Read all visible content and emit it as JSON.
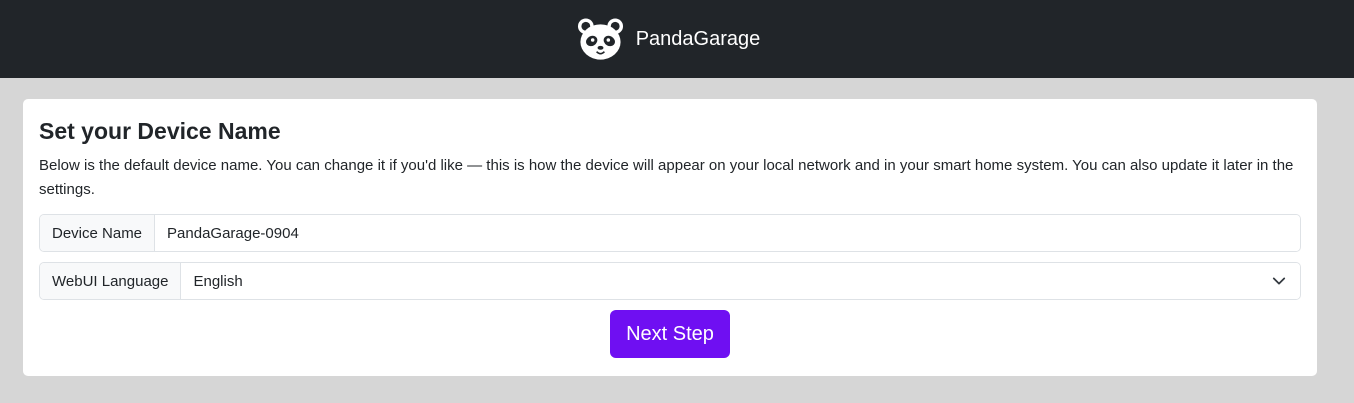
{
  "navbar": {
    "brand_name": "PandaGarage",
    "logo_icon": "panda-logo-icon",
    "background": "#212529"
  },
  "card": {
    "title": "Set your Device Name",
    "description": "Below is the default device name. You can change it if you'd like — this is how the device will appear on your local network and in your smart home system. You can also update it later in the settings.",
    "device_name": {
      "label": "Device Name",
      "value": "PandaGarage-0904"
    },
    "language": {
      "label": "WebUI Language",
      "selected": "English",
      "icon": "chevron-down-icon"
    },
    "next_button": {
      "label": "Next Step",
      "color": "#6f0ff2"
    }
  }
}
